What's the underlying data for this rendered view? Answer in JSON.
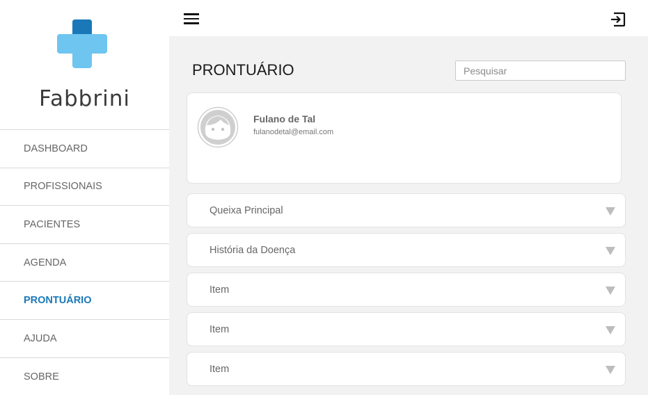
{
  "brand": {
    "name": "Fabbrini",
    "colors": {
      "cross_light": "#6ec5ef",
      "cross_dark": "#1a78b8"
    }
  },
  "sidebar": {
    "items": [
      {
        "label": "DASHBOARD",
        "active": false
      },
      {
        "label": "PROFISSIONAIS",
        "active": false
      },
      {
        "label": "PACIENTES",
        "active": false
      },
      {
        "label": "AGENDA",
        "active": false
      },
      {
        "label": "PRONTUÁRIO",
        "active": true
      },
      {
        "label": "AJUDA",
        "active": false
      },
      {
        "label": "SOBRE",
        "active": false
      }
    ]
  },
  "header": {
    "menu_icon": "hamburger-menu-icon",
    "logout_icon": "logout-icon"
  },
  "main": {
    "title": "PRONTUÁRIO",
    "search": {
      "placeholder": "Pesquisar",
      "value": ""
    },
    "patient": {
      "name": "Fulano de Tal",
      "email": "fulanodetal@email.com",
      "avatar_icon": "avatar-face-icon"
    },
    "sections": [
      {
        "label": "Queixa Principal"
      },
      {
        "label": "História da Doença"
      },
      {
        "label": "Item"
      },
      {
        "label": "Item"
      },
      {
        "label": "Item"
      }
    ]
  }
}
